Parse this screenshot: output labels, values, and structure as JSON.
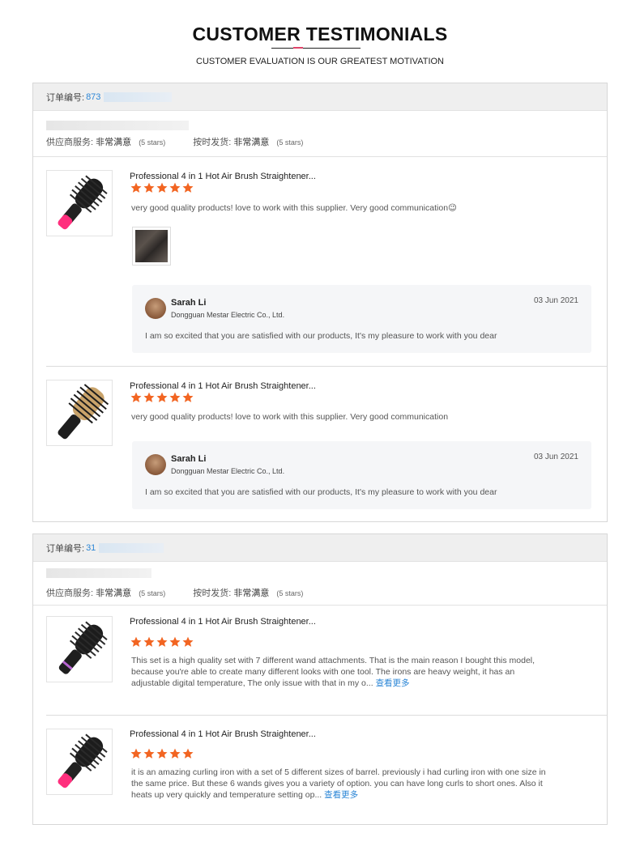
{
  "header": {
    "title": "CUSTOMER TESTIMONIALS",
    "subtitle": "CUSTOMER EVALUATION IS OUR GREATEST MOTIVATION"
  },
  "orders": [
    {
      "order_label": "订单编号:",
      "order_number": "873",
      "supplier_service_label": "供应商服务:",
      "supplier_service_value": "非常满意",
      "supplier_service_stars": "(5 stars)",
      "ontime_label": "按时发货:",
      "ontime_value": "非常满意",
      "ontime_stars": "(5 stars)",
      "reviews": [
        {
          "product_title": "Professional 4 in 1 Hot Air Brush Straightener...",
          "rating": 5,
          "text": "very good quality products! love to work with this supplier. Very good communication😉",
          "more_label": "",
          "reply": {
            "name": "Sarah Li",
            "company": "Dongguan Mestar Electric Co., Ltd.",
            "date": "03 Jun 2021",
            "message": "I am so excited that you are satisfied with our products, It's my pleasure to work with you dear"
          }
        },
        {
          "product_title": "Professional 4 in 1 Hot Air Brush Straightener...",
          "rating": 5,
          "text": "very good quality products! love to work with this supplier. Very good communication",
          "more_label": "",
          "reply": {
            "name": "Sarah Li",
            "company": "Dongguan Mestar Electric Co., Ltd.",
            "date": "03 Jun 2021",
            "message": "I am so excited that you are satisfied with our products, It's my pleasure to work with you dear"
          }
        }
      ]
    },
    {
      "order_label": "订单编号:",
      "order_number": "31",
      "supplier_service_label": "供应商服务:",
      "supplier_service_value": "非常满意",
      "supplier_service_stars": "(5 stars)",
      "ontime_label": "按时发货:",
      "ontime_value": "非常满意",
      "ontime_stars": "(5 stars)",
      "reviews": [
        {
          "product_title": "Professional 4 in 1 Hot Air Brush Straightener...",
          "rating": 5,
          "text": "This set is a high quality set with 7 different wand attachments. That is the main reason I bought this model, because you're able to create many different looks with one tool. The irons are heavy weight, it has an adjustable digital temperature, The only issue with that in my o...",
          "more_label": "查看更多"
        },
        {
          "product_title": "Professional 4 in 1 Hot Air Brush Straightener...",
          "rating": 5,
          "text": "it is an amazing curling iron with a set of 5 different sizes of barrel. previously i had curling iron with one size in the same price. But these 6 wands gives you a variety of option. you can have long curls to short ones. Also it heats up very quickly and temperature setting op...",
          "more_label": "查看更多"
        }
      ]
    }
  ],
  "colors": {
    "star": "#f26522",
    "link": "#2b86d6",
    "accent": "#e0456a"
  }
}
